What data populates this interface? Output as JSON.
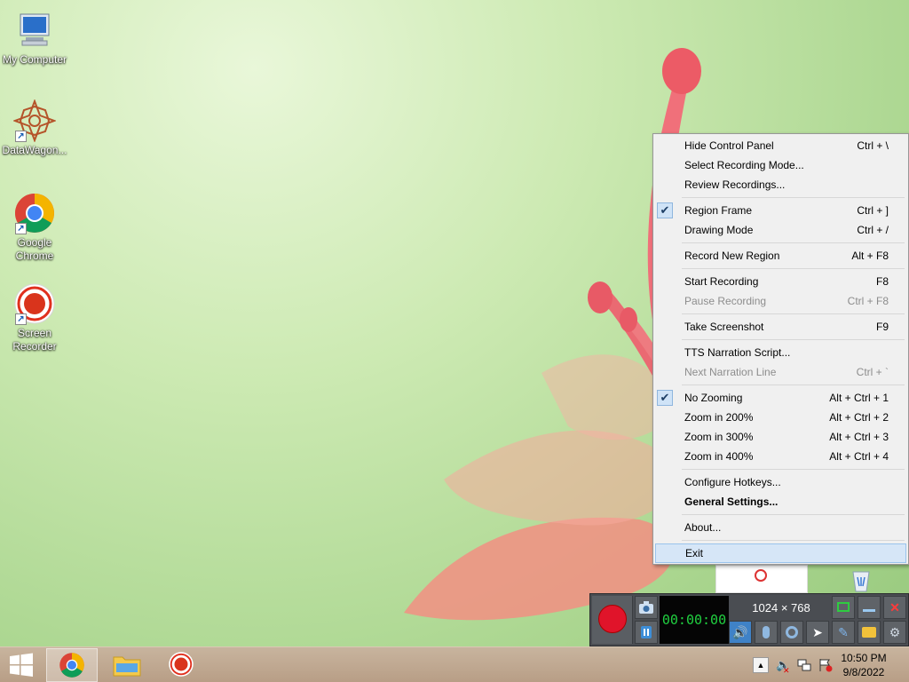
{
  "desktop": {
    "icons": [
      {
        "label": "My Computer",
        "icon": "computer-icon"
      },
      {
        "label": "DataWagon...",
        "icon": "datawagon-icon"
      },
      {
        "label": "Google Chrome",
        "icon": "chrome-icon"
      },
      {
        "label": "Screen Recorder",
        "icon": "screen-recorder-icon"
      }
    ]
  },
  "context_menu": {
    "items": [
      {
        "label": "Hide Control Panel",
        "shortcut": "Ctrl + \\"
      },
      {
        "label": "Select Recording Mode...",
        "shortcut": ""
      },
      {
        "label": "Review Recordings...",
        "shortcut": ""
      },
      {
        "label": "Region Frame",
        "shortcut": "Ctrl + ]",
        "checked": true
      },
      {
        "label": "Drawing Mode",
        "shortcut": "Ctrl + /"
      },
      {
        "label": "Record New Region",
        "shortcut": "Alt + F8"
      },
      {
        "label": "Start Recording",
        "shortcut": "F8"
      },
      {
        "label": "Pause Recording",
        "shortcut": "Ctrl + F8",
        "disabled": true
      },
      {
        "label": "Take Screenshot",
        "shortcut": "F9"
      },
      {
        "label": "TTS Narration Script...",
        "shortcut": ""
      },
      {
        "label": "Next Narration Line",
        "shortcut": "Ctrl + `",
        "disabled": true
      },
      {
        "label": "No Zooming",
        "shortcut": "Alt + Ctrl + 1",
        "checked": true
      },
      {
        "label": "Zoom in 200%",
        "shortcut": "Alt + Ctrl + 2"
      },
      {
        "label": "Zoom in 300%",
        "shortcut": "Alt + Ctrl + 3"
      },
      {
        "label": "Zoom in 400%",
        "shortcut": "Alt + Ctrl + 4"
      },
      {
        "label": "Configure Hotkeys...",
        "shortcut": ""
      },
      {
        "label": "General Settings...",
        "shortcut": "",
        "bold": true
      },
      {
        "label": "About...",
        "shortcut": ""
      },
      {
        "label": "Exit",
        "shortcut": "",
        "highlighted": true
      }
    ]
  },
  "recorder": {
    "timer": "00:00:00",
    "resolution": "1024 × 768",
    "record_color": "#e0142a"
  },
  "taskbar": {
    "apps": [
      {
        "name": "Google Chrome",
        "icon": "chrome-icon",
        "active": true
      },
      {
        "name": "File Explorer",
        "icon": "folder-icon"
      },
      {
        "name": "Screen Recorder",
        "icon": "screen-recorder-icon"
      }
    ],
    "time": "10:50 PM",
    "date": "9/8/2022"
  }
}
